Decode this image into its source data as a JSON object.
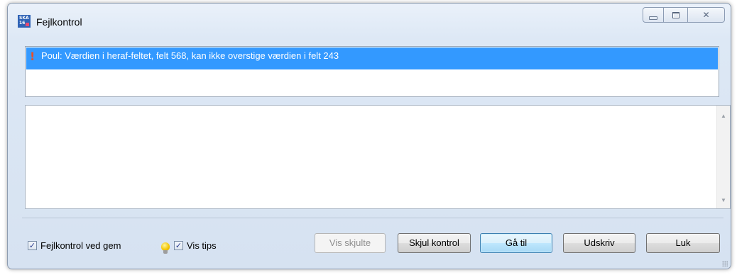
{
  "window": {
    "title": "Fejlkontrol",
    "icon": "ska-app-icon",
    "icon_text": "SKA 16"
  },
  "controls": {
    "minimize_icon": "minimize-icon",
    "maximize_icon": "maximize-icon",
    "close_glyph": "✕"
  },
  "messages": [
    {
      "icon": "warning-exclamation-icon",
      "text": "Poul: Værdien i heraf-feltet, felt 568, kan ikke overstige værdien i felt 243",
      "selected": true
    }
  ],
  "detail": {
    "text": ""
  },
  "options": {
    "fejlkontrol_ved_gem": {
      "label": "Fejlkontrol ved gem",
      "checked": true
    },
    "vis_tips": {
      "label": "Vis tips",
      "checked": true,
      "icon": "lightbulb-icon"
    }
  },
  "buttons": {
    "vis_skjulte": {
      "label": "Vis skjulte",
      "enabled": false
    },
    "skjul_kontrol": {
      "label": "Skjul kontrol"
    },
    "gaa_til": {
      "label": "Gå til",
      "default": true
    },
    "udskriv": {
      "label": "Udskriv"
    },
    "luk": {
      "label": "Luk"
    }
  },
  "colors": {
    "selection": "#3399ff",
    "warning": "#e8502a",
    "window_bg": "#d6e2f1"
  }
}
